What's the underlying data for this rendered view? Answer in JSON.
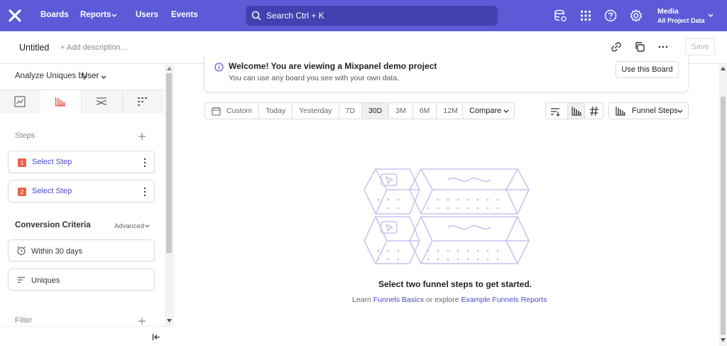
{
  "nav": {
    "items": [
      "Boards",
      "Reports",
      "Users",
      "Events"
    ],
    "search_placeholder": "Search  Ctrl + K",
    "project_name": "Media",
    "project_data": "All Project Data",
    "brand_color": "#5d5ad8"
  },
  "titlebar": {
    "title": "Untitled",
    "add_description": "+ Add description...",
    "save_label": "Save"
  },
  "left": {
    "analyze_label": "Analyze Uniques by",
    "analyze_value": "User",
    "steps_label": "Steps",
    "steps": [
      {
        "num": "1",
        "label": "Select Step"
      },
      {
        "num": "2",
        "label": "Select Step"
      }
    ],
    "conversion_label": "Conversion Criteria",
    "advanced_label": "Advanced",
    "window_label": "Within 30 days",
    "uniques_label": "Uniques",
    "filter_label": "Filter"
  },
  "banner": {
    "title": "Welcome! You are viewing a Mixpanel demo project",
    "subtitle": "You can use any board you see with your own data.",
    "button": "Use this Board"
  },
  "toolbar": {
    "date_ranges": [
      "Custom",
      "Today",
      "Yesterday",
      "7D",
      "30D",
      "3M",
      "6M",
      "12M"
    ],
    "active_range": "30D",
    "compare_label": "Compare",
    "chart_type_label": "Funnel Steps"
  },
  "empty": {
    "title": "Select two funnel steps to get started.",
    "learn": "Learn",
    "link1": "Funnels Basics",
    "or_explore": "or explore",
    "link2": "Example Funnels Reports"
  }
}
